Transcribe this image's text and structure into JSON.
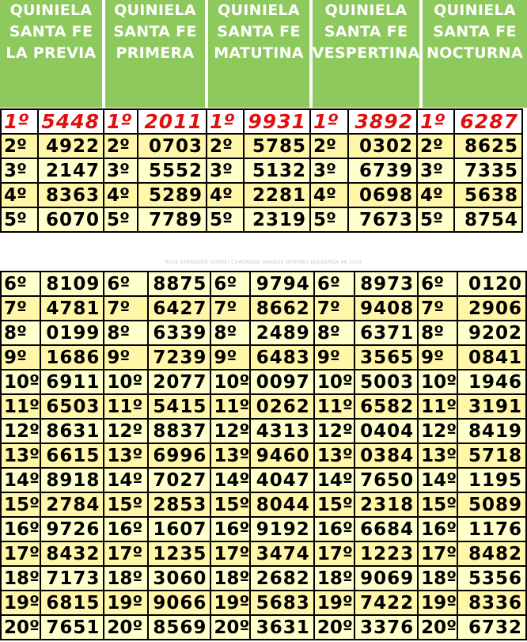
{
  "headers": [
    [
      "QUINIELA",
      "SANTA FE",
      "LA PREVIA"
    ],
    [
      "QUINIELA",
      "SANTA FE",
      "PRIMERA"
    ],
    [
      "QUINIELA",
      "SANTA FE",
      "MATUTINA"
    ],
    [
      "QUINIELA",
      "SANTA FE",
      "VESPERTINA"
    ],
    [
      "QUINIELA",
      "SANTA FE",
      "NOCTURNA"
    ]
  ],
  "positions_top": [
    "1º",
    "2º",
    "3º",
    "4º",
    "5º"
  ],
  "positions_bottom": [
    "6º",
    "7º",
    "8º",
    "9º",
    "10º",
    "11º",
    "12º",
    "13º",
    "14º",
    "15º",
    "16º",
    "17º",
    "18º",
    "19º",
    "20º"
  ],
  "top_rows": [
    [
      "5448",
      "2011",
      "9931",
      "3892",
      "6287"
    ],
    [
      "4922",
      "0703",
      "5785",
      "0302",
      "8625"
    ],
    [
      "2147",
      "5552",
      "5132",
      "6739",
      "7335"
    ],
    [
      "8363",
      "5289",
      "2281",
      "0698",
      "5638"
    ],
    [
      "6070",
      "7789",
      "2319",
      "7673",
      "8754"
    ]
  ],
  "bottom_rows": [
    [
      "8109",
      "8875",
      "9794",
      "8973",
      "0120"
    ],
    [
      "4781",
      "6427",
      "8662",
      "9408",
      "2906"
    ],
    [
      "0199",
      "6339",
      "2489",
      "6371",
      "9202"
    ],
    [
      "1686",
      "7239",
      "6483",
      "3565",
      "0841"
    ],
    [
      "6911",
      "2077",
      "0097",
      "5003",
      "1946"
    ],
    [
      "6503",
      "5415",
      "0262",
      "6582",
      "3191"
    ],
    [
      "8631",
      "8837",
      "4313",
      "0404",
      "8419"
    ],
    [
      "6615",
      "6996",
      "9460",
      "0384",
      "5718"
    ],
    [
      "8918",
      "7027",
      "4047",
      "7650",
      "1195"
    ],
    [
      "2784",
      "2853",
      "8044",
      "2318",
      "5089"
    ],
    [
      "9726",
      "1607",
      "9192",
      "6684",
      "1176"
    ],
    [
      "8432",
      "1235",
      "3474",
      "1223",
      "8482"
    ],
    [
      "7173",
      "3060",
      "2682",
      "9069",
      "5356"
    ],
    [
      "6815",
      "9066",
      "5683",
      "7422",
      "8336"
    ],
    [
      "7651",
      "8569",
      "3631",
      "3376",
      "6732"
    ]
  ],
  "watermark": "RUTA STANDARD (HOME) CUADRADO GRANDE INTERNO IZQUIERDA 08.2014",
  "colors": {
    "header_green": "#8ec95e",
    "header_text": "#ffffff",
    "first_prize": "#e01010",
    "cell_light": "#ffffcc",
    "cell_yellow": "#fff6a8"
  }
}
